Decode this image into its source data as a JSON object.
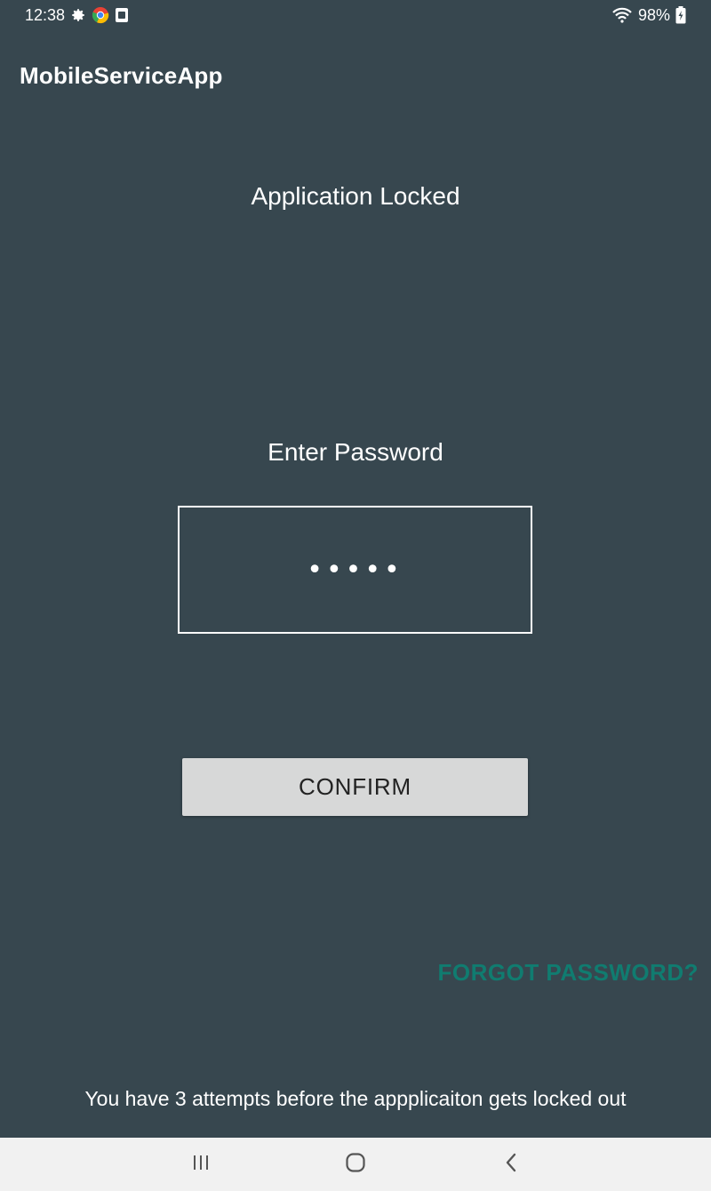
{
  "status_bar": {
    "time": "12:38",
    "notification_icons": [
      "gear-icon",
      "chrome-icon",
      "screenshot-icon"
    ],
    "battery_percent": "98%",
    "wifi_icon": "wifi-icon",
    "battery_icon": "battery-charging-icon"
  },
  "app": {
    "title": "MobileServiceApp"
  },
  "lock_screen": {
    "heading": "Application Locked",
    "password_label": "Enter Password",
    "password_value": "•••••",
    "confirm_label": "CONFIRM",
    "forgot_label": "FORGOT PASSWORD?",
    "attempts_message": "You have 3 attempts before the appplicaiton gets locked out"
  },
  "nav_bar": {
    "recents_icon": "recents-icon",
    "home_icon": "home-icon",
    "back_icon": "back-icon"
  },
  "colors": {
    "background": "#37474f",
    "accent": "#107c70",
    "button": "#d7d8d8",
    "nav_bar": "#f1f1f1"
  }
}
